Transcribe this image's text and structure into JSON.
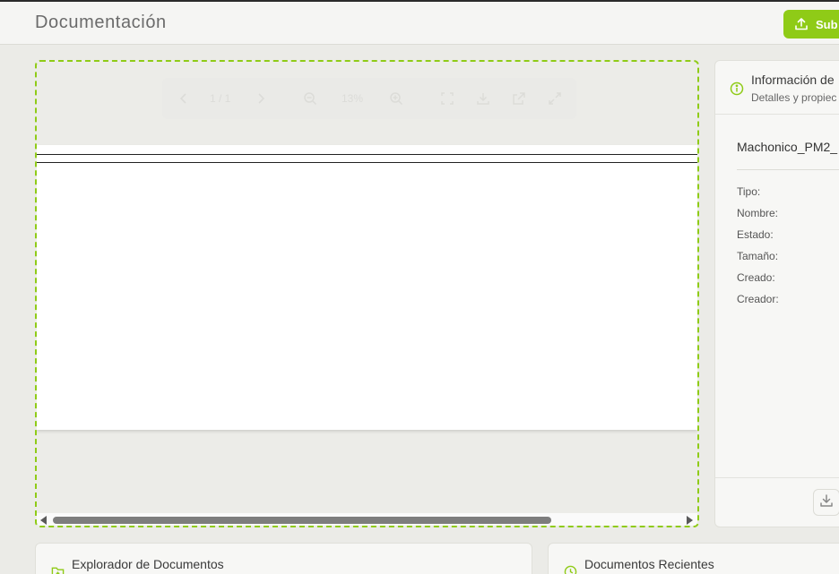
{
  "header": {
    "title": "Documentación",
    "upload_label": "Sub"
  },
  "viewer": {
    "page_indicator": "1 / 1",
    "zoom": "13%"
  },
  "info_panel": {
    "title": "Información de",
    "subtitle": "Detalles y propiec",
    "file_name": "Machonico_PM2_",
    "properties": [
      "Tipo:",
      "Nombre:",
      "Estado:",
      "Tamaño:",
      "Creado:",
      "Creador:"
    ]
  },
  "cards": {
    "explorer_title": "Explorador de Documentos",
    "recent_title": "Documentos Recientes"
  },
  "colors": {
    "accent": "#8fcb17",
    "background": "#ebebe7"
  },
  "icons": [
    "upload-icon",
    "chevron-left-icon",
    "chevron-right-icon",
    "zoom-out-icon",
    "zoom-in-icon",
    "fit-page-icon",
    "download-icon",
    "open-external-icon",
    "fullscreen-icon",
    "info-icon",
    "folder-icon",
    "clock-icon"
  ]
}
